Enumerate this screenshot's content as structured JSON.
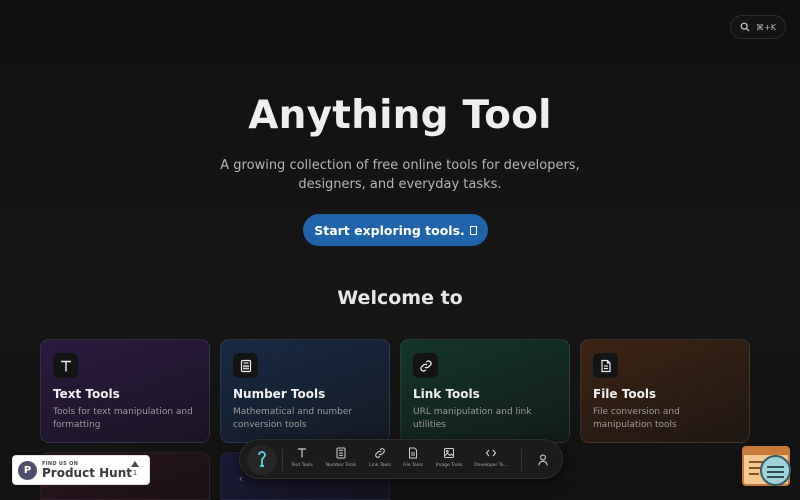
{
  "search": {
    "shortcut": "⌘+K",
    "icon": "search-icon"
  },
  "hero": {
    "title": "Anything Tool",
    "subtitle": "A growing collection of free online tools for developers, designers, and everyday tasks.",
    "cta_label": "Start exploring tools."
  },
  "welcome": {
    "heading": "Welcome to"
  },
  "cards": [
    {
      "title": "Text Tools",
      "description": "Tools for text manipulation and formatting",
      "icon": "text-icon"
    },
    {
      "title": "Number Tools",
      "description": "Mathematical and number conversion tools",
      "icon": "calculator-icon"
    },
    {
      "title": "Link Tools",
      "description": "URL manipulation and link utilities",
      "icon": "link-icon"
    },
    {
      "title": "File Tools",
      "description": "File conversion and manipulation tools",
      "icon": "file-icon"
    }
  ],
  "dock": {
    "items": [
      {
        "label": "Text Tools",
        "icon": "text-icon"
      },
      {
        "label": "Number Tools",
        "icon": "calculator-icon"
      },
      {
        "label": "Link Tools",
        "icon": "link-icon"
      },
      {
        "label": "File Tools",
        "icon": "file-icon"
      },
      {
        "label": "Image Tools",
        "icon": "image-icon"
      },
      {
        "label": "Developer To...",
        "icon": "code-icon"
      }
    ]
  },
  "product_hunt": {
    "kicker": "FIND US ON",
    "name": "Product Hunt",
    "votes": "1",
    "logo_letter": "P"
  },
  "colors": {
    "accent": "#1f63a8",
    "background": "#141414"
  }
}
